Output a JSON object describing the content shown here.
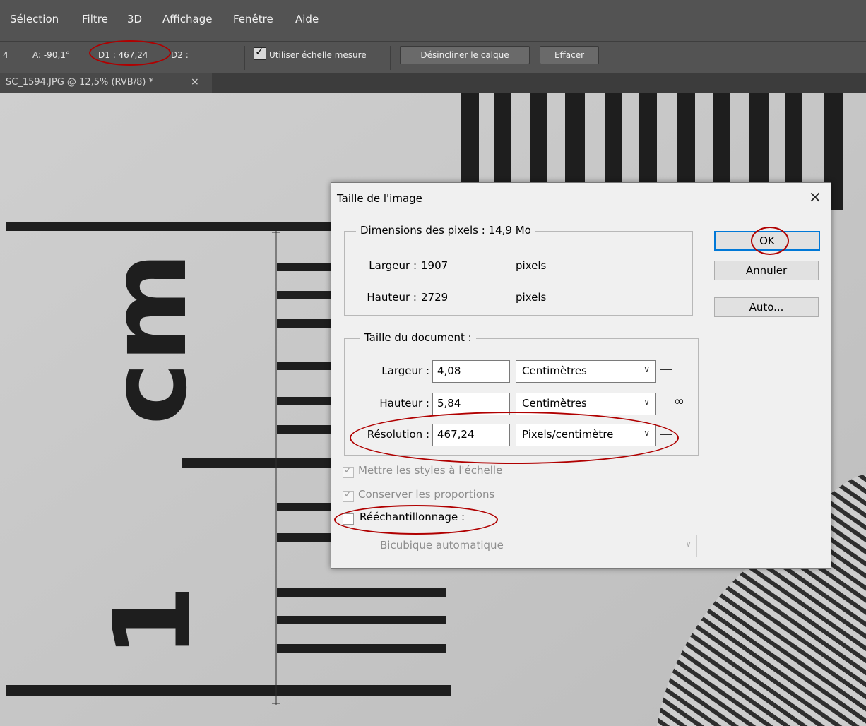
{
  "menu": {
    "items": [
      "Sélection",
      "Filtre",
      "3D",
      "Affichage",
      "Fenêtre",
      "Aide"
    ]
  },
  "options_bar": {
    "angle": "A: -90,1°",
    "d1": "D1 : 467,24",
    "d2": "D2 :",
    "lead": "4",
    "use_scale_label": "Utiliser échelle mesure",
    "use_scale_checked": true,
    "straighten_button": "Désincliner le calque",
    "clear_button": "Effacer"
  },
  "doc_tab": {
    "title": "SC_1594.JPG @ 12,5% (RVB/8) *",
    "close": "×"
  },
  "dialog": {
    "title": "Taille de l'image",
    "close": "×",
    "pixel_dims": {
      "title": "Dimensions des pixels : 14,9 Mo",
      "width_label": "Largeur :",
      "width_value": "1907",
      "width_unit": "pixels",
      "height_label": "Hauteur :",
      "height_value": "2729",
      "height_unit": "pixels"
    },
    "doc_size": {
      "title": "Taille du document :",
      "width_label": "Largeur :",
      "width_value": "4,08",
      "width_unit": "Centimètres",
      "height_label": "Hauteur :",
      "height_value": "5,84",
      "height_unit": "Centimètres",
      "resolution_label": "Résolution :",
      "resolution_value": "467,24",
      "resolution_unit": "Pixels/centimètre"
    },
    "options": {
      "scale_styles": "Mettre les styles à l'échelle",
      "constrain": "Conserver les proportions",
      "resample": "Rééchantillonnage :",
      "resample_method": "Bicubique automatique"
    },
    "buttons": {
      "ok": "OK",
      "cancel": "Annuler",
      "auto": "Auto..."
    }
  },
  "colors": {
    "annotation": "#b00000",
    "accent": "#0078d7"
  }
}
